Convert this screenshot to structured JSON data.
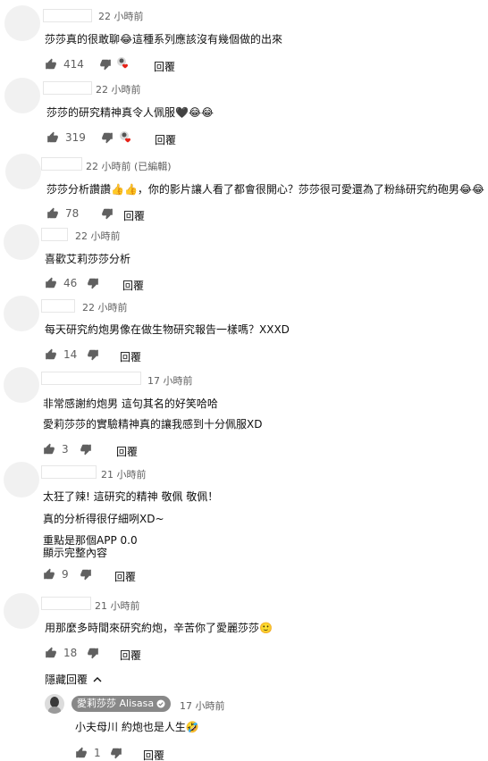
{
  "comments": [
    {
      "time": "22 小時前",
      "text": "莎莎真的很敢聊😂這種系列應該沒有幾個做的出來",
      "likes": "414",
      "reply": "回覆"
    },
    {
      "time": "22 小時前",
      "text": "莎莎的研究精神真令人佩服🖤😂😂",
      "likes": "319",
      "reply": "回覆"
    },
    {
      "time": "22 小時前 (已編輯)",
      "text": "莎莎分析讚讚👍👍，你的影片讓人看了都會很開心？莎莎很可愛還為了粉絲研究約砲男😂😂",
      "likes": "78",
      "reply": "回覆"
    },
    {
      "time": "22 小時前",
      "text": "喜歡艾莉莎莎分析",
      "likes": "46",
      "reply": "回覆"
    },
    {
      "time": "22 小時前",
      "text": "每天研究約炮男像在做生物研究報告一樣嗎？XXXD",
      "likes": "14",
      "reply": "回覆"
    },
    {
      "time": "17 小時前",
      "text_lines": [
        "非常感謝約炮男 這句其名的好笑哈哈",
        "愛莉莎莎的實驗精神真的讓我感到十分佩服XD"
      ],
      "likes": "3",
      "reply": "回覆"
    },
    {
      "time": "21 小時前",
      "text_lines": [
        "太狂了辣! 這研究的精神 敬佩 敬佩！",
        "真的分析得很仔細咧XD~",
        "重點是那個APP 0.0",
        "顯示完整內容"
      ],
      "likes": "9",
      "reply": "回覆"
    },
    {
      "time": "21 小時前",
      "text": "用那麼多時間來研究約炮，辛苦你了愛麗莎莎🙂",
      "likes": "18",
      "reply": "回覆"
    }
  ],
  "hide_replies": "隱藏回覆",
  "reply_comment": {
    "author": "愛莉莎莎 Alisasa",
    "time": "17 小時前",
    "text": "小夫母川 約炮也是人生🤣",
    "likes": "1",
    "reply": "回覆"
  },
  "colors": {
    "heart": "#e62117",
    "badge_bg": "#888888",
    "meta": "#606060"
  },
  "icons": {
    "like": "thumbs-up-icon",
    "dislike": "thumbs-down-icon",
    "heart": "creator-heart-icon",
    "verified": "check-icon",
    "chevron": "chevron-up-icon"
  }
}
